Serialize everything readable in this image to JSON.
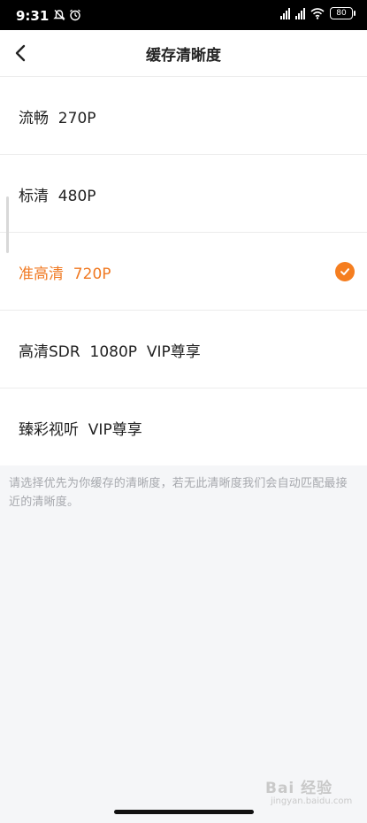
{
  "status_bar": {
    "time": "9:31",
    "battery": "80",
    "icons": [
      "mute-icon",
      "alarm-icon",
      "hd-signal-icon",
      "hd-signal-icon",
      "wifi-icon",
      "battery-icon"
    ]
  },
  "header": {
    "title": "缓存清晰度",
    "back_icon": "chevron-left-icon"
  },
  "options": [
    {
      "label": "流畅  270P",
      "selected": false
    },
    {
      "label": "标清  480P",
      "selected": false
    },
    {
      "label": "准高清  720P",
      "selected": true
    },
    {
      "label": "高清SDR  1080P  VIP尊享",
      "selected": false
    },
    {
      "label": "臻彩视听  VIP尊享",
      "selected": false
    }
  ],
  "hint": "请选择优先为你缓存的清晰度，若无此清晰度我们会自动匹配最接近的清晰度。",
  "watermark": {
    "brand": "Bai 经验",
    "url": "jingyan.baidu.com"
  },
  "colors": {
    "accent": "#f57e20",
    "background": "#f5f6f8",
    "text": "#222222",
    "hint_text": "#a6a8ad"
  }
}
